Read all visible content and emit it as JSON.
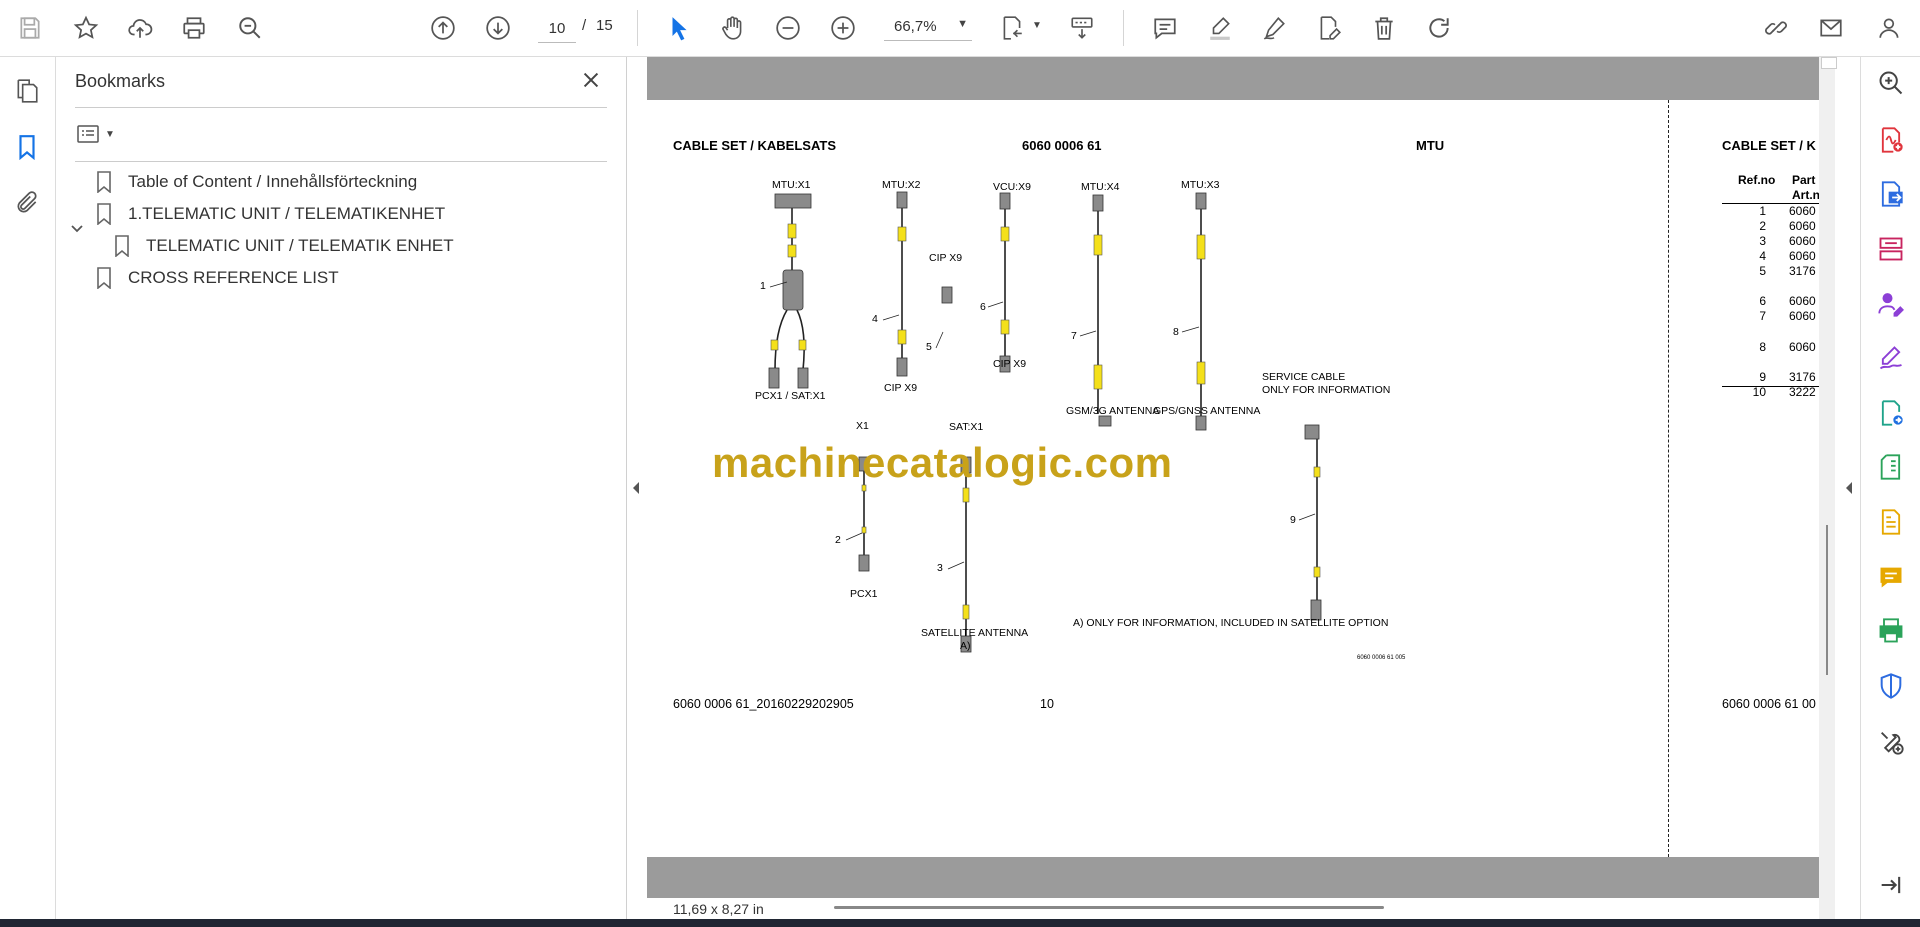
{
  "toolbar": {
    "icons": [
      "save-icon",
      "bookmark-star-icon",
      "upload-cloud-icon",
      "print-icon",
      "find-icon",
      "prev-page-icon",
      "next-page-icon",
      "select-arrow-icon",
      "hand-tool-icon",
      "zoom-out-icon",
      "zoom-in-icon",
      "fit-page-icon",
      "scrolling-mode-icon",
      "comment-icon",
      "highlight-icon",
      "draw-icon",
      "edit-pdf-icon",
      "delete-icon",
      "redo-icon",
      "share-link-icon",
      "email-icon",
      "account-icon"
    ],
    "page_current": "10",
    "page_separator": "/",
    "page_total": "15",
    "zoom": "66,7%"
  },
  "bookmarks": {
    "title": "Bookmarks",
    "items": [
      {
        "label": "Table of Content / Innehållsförteckning",
        "level": 0,
        "expandable": false
      },
      {
        "label": "1.TELEMATIC UNIT / TELEMATIKENHET",
        "level": 0,
        "expandable": true,
        "expanded": true
      },
      {
        "label": "TELEMATIC UNIT / TELEMATIK ENHET",
        "level": 1,
        "expandable": false
      },
      {
        "label": "CROSS REFERENCE LIST",
        "level": 0,
        "expandable": false
      }
    ]
  },
  "document": {
    "header_left": "CABLE SET / KABELSATS",
    "header_center": "6060 0006 61",
    "header_right": "MTU",
    "next_page_header": "CABLE SET / K",
    "labels": {
      "mtu_x1": "MTU:X1",
      "mtu_x2": "MTU:X2",
      "vcu_x9": "VCU:X9",
      "mtu_x4": "MTU:X4",
      "mtu_x3": "MTU:X3",
      "cip_x9_top": "CIP X9",
      "cip_x9_mid": "CIP X9",
      "cip_x9_bottom": "CIP X9",
      "pcx1_satx1": "PCX1 / SAT:X1",
      "gsm_antenna": "GSM/3G ANTENNA",
      "gps_antenna": "GPS/GNSS ANTENNA",
      "service_cable_1": "SERVICE CABLE",
      "service_cable_2": "ONLY FOR INFORMATION",
      "x1": "X1",
      "sat_x1": "SAT:X1",
      "pcx1": "PCX1",
      "satellite_antenna": "SATELLITE ANTENNA",
      "note_a": "A)",
      "footnote": "A) ONLY FOR INFORMATION, INCLUDED IN SATELLITE OPTION",
      "drawing_no": "6060 0006 61 005"
    },
    "callouts": [
      "1",
      "2",
      "3",
      "4",
      "5",
      "6",
      "7",
      "8",
      "9"
    ],
    "footer_left": "6060 0006 61_20160229202905",
    "footer_page": "10",
    "next_page_footer": "6060 0006 61 00",
    "watermark": "machinecatalogic.com",
    "parts_list": {
      "col_ref": "Ref.no",
      "col_part_1": "Part n",
      "col_part_2": "Art.n",
      "rows": [
        {
          "ref": "1",
          "part": "6060"
        },
        {
          "ref": "2",
          "part": "6060"
        },
        {
          "ref": "3",
          "part": "6060"
        },
        {
          "ref": "4",
          "part": "6060"
        },
        {
          "ref": "5",
          "part": "3176"
        },
        {
          "ref": "6",
          "part": "6060"
        },
        {
          "ref": "7",
          "part": "6060"
        },
        {
          "ref": "8",
          "part": "6060"
        },
        {
          "ref": "9",
          "part": "3176"
        },
        {
          "ref": "10",
          "part": "3222"
        }
      ]
    }
  },
  "status": {
    "page_size": "11,69 x 8,27 in"
  },
  "right_rail": {
    "icons": [
      "zoom-search-icon",
      "create-pdf-icon",
      "export-pdf-icon",
      "organize-pages-icon",
      "request-signatures-icon",
      "fill-sign-icon",
      "send-for-review-icon",
      "compress-pdf-icon",
      "scan-ocr-icon",
      "comment-panel-icon",
      "print-production-icon",
      "protect-icon",
      "more-tools-icon",
      "expand-panel-icon"
    ]
  },
  "colors": {
    "accent": "#1473e6",
    "panel_gray": "#9b9b9b",
    "watermark": "#c8a21a",
    "cable_yellow": "#f4e01a"
  }
}
